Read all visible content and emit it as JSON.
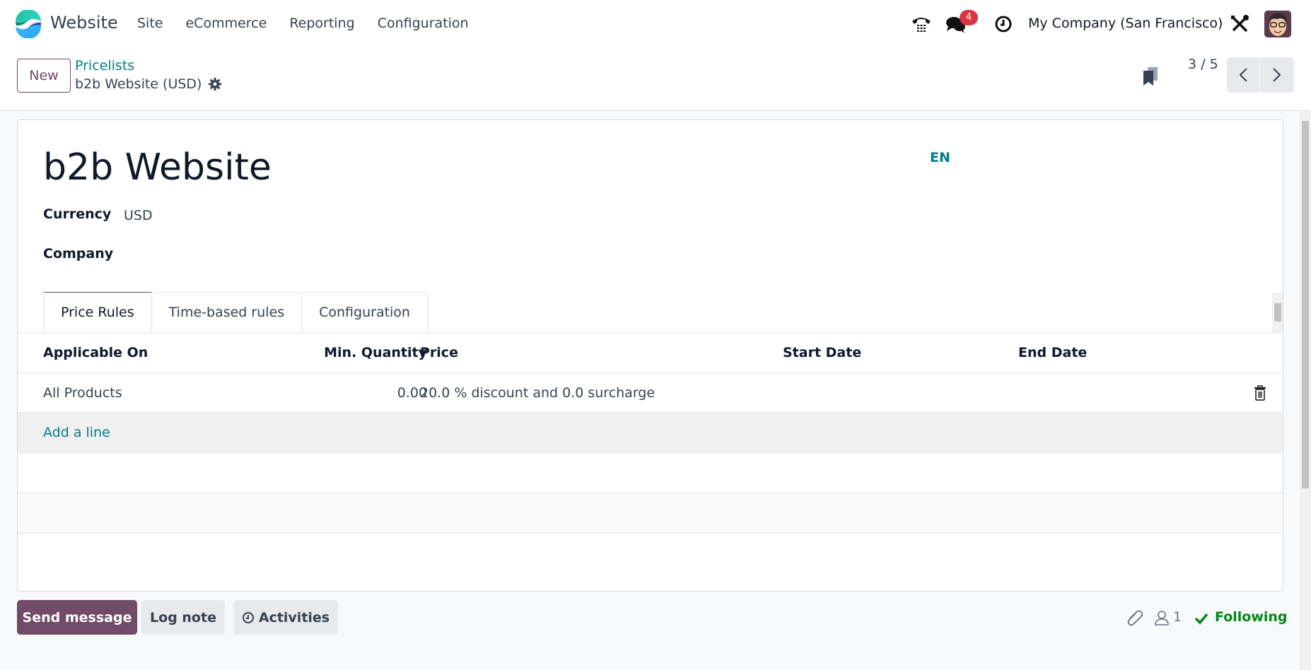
{
  "navbar": {
    "app_name": "Website",
    "menu": [
      "Site",
      "eCommerce",
      "Reporting",
      "Configuration"
    ],
    "messages_badge": "4",
    "company": "My Company (San Francisco)"
  },
  "control_panel": {
    "new_label": "New",
    "breadcrumb_parent": "Pricelists",
    "breadcrumb_current": "b2b Website (USD)",
    "pager": "3 / 5"
  },
  "form": {
    "name": "b2b Website",
    "lang_badge": "EN",
    "fields": [
      {
        "label": "Currency",
        "value": "USD"
      },
      {
        "label": "Company",
        "value": ""
      }
    ],
    "tabs": [
      {
        "label": "Price Rules",
        "active": true
      },
      {
        "label": "Time-based rules",
        "active": false
      },
      {
        "label": "Configuration",
        "active": false
      }
    ]
  },
  "table": {
    "columns": [
      "Applicable On",
      "Min. Quantity",
      "Price",
      "Start Date",
      "End Date"
    ],
    "rows": [
      {
        "applicable_on": "All Products",
        "min_quantity": "0.00",
        "price": "20.0 % discount and 0.0 surcharge",
        "start_date": "",
        "end_date": ""
      }
    ],
    "add_line": "Add a line"
  },
  "chatter": {
    "send_message": "Send message",
    "log_note": "Log note",
    "activities": "Activities",
    "followers_count": "1",
    "following": "Following"
  },
  "colors": {
    "primary": "#714b67",
    "link": "#017e84",
    "success": "#008818",
    "badge": "#dc3545"
  }
}
